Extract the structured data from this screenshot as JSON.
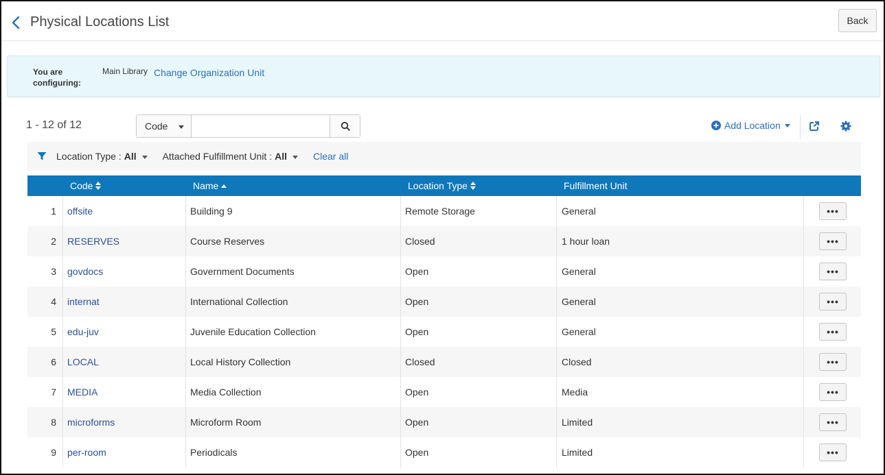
{
  "header": {
    "title": "Physical Locations List",
    "back_label": "Back"
  },
  "config": {
    "label": "You are configuring:",
    "org_unit": "Main Library",
    "change_link": "Change Organization Unit"
  },
  "toolbar": {
    "range": "1 - 12 of 12",
    "search_field": "Code",
    "search_value": "",
    "add_location": "Add Location"
  },
  "filters": {
    "location_type_label": "Location Type :",
    "location_type_value": "All",
    "fulfillment_label": "Attached Fulfillment Unit :",
    "fulfillment_value": "All",
    "clear_all": "Clear all"
  },
  "table": {
    "columns": [
      "Code",
      "Name",
      "Location Type",
      "Fulfillment Unit"
    ],
    "rows": [
      {
        "num": "1",
        "code": "offsite",
        "name": "Building 9",
        "type": "Remote Storage",
        "unit": "General"
      },
      {
        "num": "2",
        "code": "RESERVES",
        "name": "Course Reserves",
        "type": "Closed",
        "unit": "1 hour loan"
      },
      {
        "num": "3",
        "code": "govdocs",
        "name": "Government Documents",
        "type": "Open",
        "unit": "General"
      },
      {
        "num": "4",
        "code": "internat",
        "name": "International Collection",
        "type": "Open",
        "unit": "General"
      },
      {
        "num": "5",
        "code": "edu-juv",
        "name": "Juvenile Education Collection",
        "type": "Open",
        "unit": "General"
      },
      {
        "num": "6",
        "code": "LOCAL",
        "name": "Local History Collection",
        "type": "Closed",
        "unit": "Closed"
      },
      {
        "num": "7",
        "code": "MEDIA",
        "name": "Media Collection",
        "type": "Open",
        "unit": "Media"
      },
      {
        "num": "8",
        "code": "microforms",
        "name": "Microform Room",
        "type": "Open",
        "unit": "Limited"
      },
      {
        "num": "9",
        "code": "per-room",
        "name": "Periodicals",
        "type": "Open",
        "unit": "Limited"
      }
    ],
    "row_action": "•••"
  },
  "colors": {
    "accent": "#0f78ba",
    "link": "#2a6fb8",
    "banner": "#e8f7fc"
  }
}
